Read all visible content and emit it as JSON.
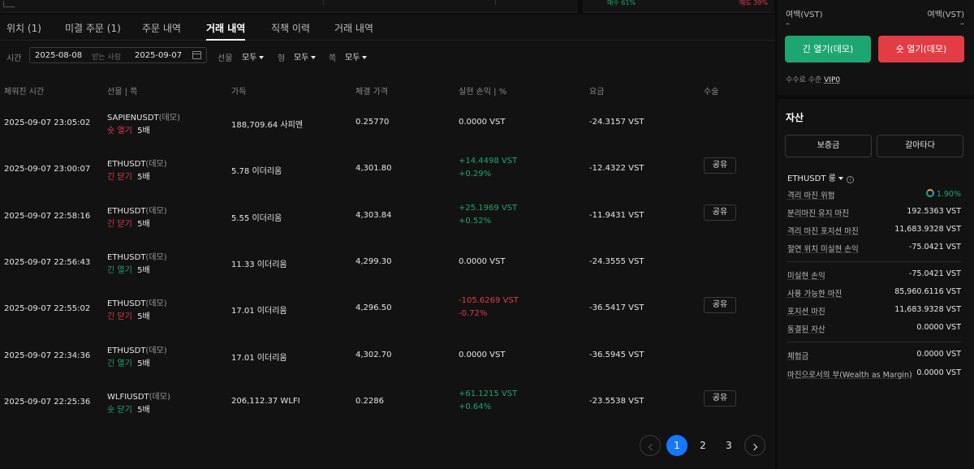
{
  "top_strip": {
    "buy_ratio": "매수 61%",
    "sell_ratio": "매도 39%"
  },
  "tabs": [
    {
      "label": "위치 (1)"
    },
    {
      "label": "미결 주문 (1)"
    },
    {
      "label": "주문 내역"
    },
    {
      "label": "거래 내역"
    },
    {
      "label": "직책 이력"
    },
    {
      "label": "거래 내역"
    }
  ],
  "filters": {
    "time_label": "시간",
    "date_from": "2025-08-08",
    "date_sep": "받는 사람",
    "date_to": "2025-09-07",
    "futures_label": "선물",
    "futures_value": "모두",
    "type_label": "형",
    "type_value": "모두",
    "side_label": "쪽",
    "side_value": "모두"
  },
  "columns": [
    "체워진 시간",
    "선물 | 쪽",
    "가득",
    "체결 가격",
    "실현 손익 | %",
    "요금",
    "수술"
  ],
  "rows": [
    {
      "time": "2025-09-07 23:05:02",
      "symbol": "SAPIENUSDT",
      "demo": "(데모)",
      "side": "숏 열기",
      "side_color": "neg",
      "leverage": "5배",
      "qty": "188,709.64  사피엔",
      "price": "0.25770",
      "pnl": "0.0000  VST",
      "pnl_pct": "",
      "pnl_color": "muted",
      "fee": "-24.3157 VST",
      "share": ""
    },
    {
      "time": "2025-09-07 23:00:07",
      "symbol": "ETHUSDT",
      "demo": "(데모)",
      "side": "긴 닫기",
      "side_color": "neg",
      "leverage": "5배",
      "qty": "5.78  이더리움",
      "price": "4,301.80",
      "pnl": "+14.4498  VST",
      "pnl_pct": "+0.29%",
      "pnl_color": "pos",
      "fee": "-12.4322 VST",
      "share": "공유"
    },
    {
      "time": "2025-09-07 22:58:16",
      "symbol": "ETHUSDT",
      "demo": "(데모)",
      "side": "긴 닫기",
      "side_color": "neg",
      "leverage": "5배",
      "qty": "5.55  이더리움",
      "price": "4,303.84",
      "pnl": "+25.1969  VST",
      "pnl_pct": "+0.52%",
      "pnl_color": "pos",
      "fee": "-11.9431 VST",
      "share": "공유"
    },
    {
      "time": "2025-09-07 22:56:43",
      "symbol": "ETHUSDT",
      "demo": "(데모)",
      "side": "긴 열기",
      "side_color": "pos",
      "leverage": "5배",
      "qty": "11.33  이더리움",
      "price": "4,299.30",
      "pnl": "0.0000  VST",
      "pnl_pct": "",
      "pnl_color": "muted",
      "fee": "-24.3555 VST",
      "share": ""
    },
    {
      "time": "2025-09-07 22:55:02",
      "symbol": "ETHUSDT",
      "demo": "(데모)",
      "side": "긴 닫기",
      "side_color": "neg",
      "leverage": "5배",
      "qty": "17.01  이더리움",
      "price": "4,296.50",
      "pnl": "-105.6269  VST",
      "pnl_pct": "-0.72%",
      "pnl_color": "neg",
      "fee": "-36.5417 VST",
      "share": "공유"
    },
    {
      "time": "2025-09-07 22:34:36",
      "symbol": "ETHUSDT",
      "demo": "(데모)",
      "side": "긴 열기",
      "side_color": "pos",
      "leverage": "5배",
      "qty": "17.01  이더리움",
      "price": "4,302.70",
      "pnl": "0.0000  VST",
      "pnl_pct": "",
      "pnl_color": "muted",
      "fee": "-36.5945 VST",
      "share": ""
    },
    {
      "time": "2025-09-07 22:25:36",
      "symbol": "WLFIUSDT",
      "demo": "(데모)",
      "side": "숏 닫기",
      "side_color": "pos",
      "leverage": "5배",
      "qty": "206,112.37  WLFI",
      "price": "0.2286",
      "pnl": "+61.1215  VST",
      "pnl_pct": "+0.64%",
      "pnl_color": "pos",
      "fee": "-23.5538 VST",
      "share": "공유"
    }
  ],
  "pagination": {
    "pages": [
      "1",
      "2",
      "3"
    ],
    "current": "1"
  },
  "right": {
    "avail_label_left": "여백(VST)",
    "avail_label_right": "여백(VST)",
    "avail_value_left": "–",
    "avail_value_right": "–",
    "long_button": "긴 열기(데모)",
    "short_button": "숏 열기(데모)",
    "fee_tier_label": "수수료 수준",
    "fee_tier_value": "VIP0",
    "assets_title": "자산",
    "deposit_button": "보증금",
    "transfer_button": "갈아타다",
    "account_select": "ETHUSDT 룽",
    "metrics_1": [
      {
        "label": "격리 마진 위험",
        "value": "1.90%"
      },
      {
        "label": "분리마진 유지 마진",
        "value": "192.5363 VST"
      },
      {
        "label": "격리 마진 포지션 마진",
        "value": "11,683.9328 VST"
      },
      {
        "label": "절연 위치 미실현 손익",
        "value": "-75.0421 VST"
      }
    ],
    "metrics_2": [
      {
        "label": "미실현 손익",
        "value": "-75.0421 VST"
      },
      {
        "label": "사용 가능한 마진",
        "value": "85,960.6116 VST"
      },
      {
        "label": "포지션 마진",
        "value": "11,683.9328 VST"
      },
      {
        "label": "동결된 자산",
        "value": "0.0000 VST"
      }
    ],
    "metrics_3": [
      {
        "label": "체험금",
        "value": "0.0000 VST"
      },
      {
        "label": "마진으로서의 부(Wealth as Margin)",
        "value": "0.0000 VST"
      }
    ]
  }
}
